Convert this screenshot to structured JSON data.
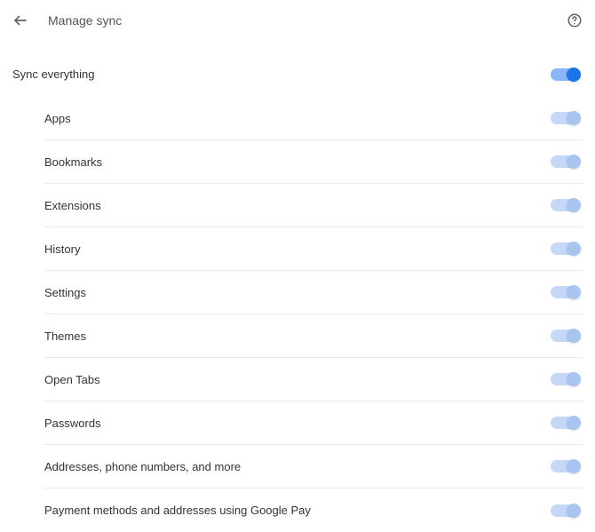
{
  "header": {
    "title": "Manage sync"
  },
  "master": {
    "label": "Sync everything",
    "on": true,
    "enabled": true
  },
  "items": [
    {
      "label": "Apps",
      "on": true,
      "enabled": false
    },
    {
      "label": "Bookmarks",
      "on": true,
      "enabled": false
    },
    {
      "label": "Extensions",
      "on": true,
      "enabled": false
    },
    {
      "label": "History",
      "on": true,
      "enabled": false
    },
    {
      "label": "Settings",
      "on": true,
      "enabled": false
    },
    {
      "label": "Themes",
      "on": true,
      "enabled": false
    },
    {
      "label": "Open Tabs",
      "on": true,
      "enabled": false
    },
    {
      "label": "Passwords",
      "on": true,
      "enabled": false
    },
    {
      "label": "Addresses, phone numbers, and more",
      "on": true,
      "enabled": false
    },
    {
      "label": "Payment methods and addresses using Google Pay",
      "on": true,
      "enabled": false
    }
  ]
}
